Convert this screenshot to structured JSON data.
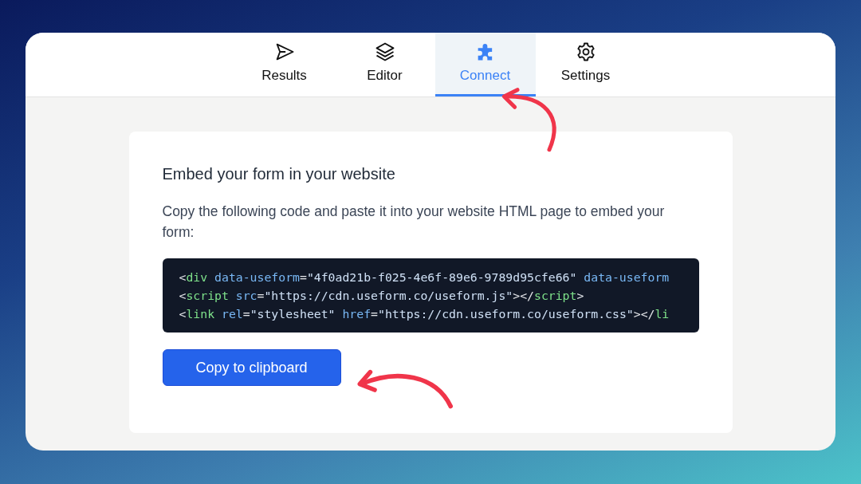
{
  "tabs": [
    {
      "label": "Results",
      "selected": false
    },
    {
      "label": "Editor",
      "selected": false
    },
    {
      "label": "Connect",
      "selected": true
    },
    {
      "label": "Settings",
      "selected": false
    }
  ],
  "embed": {
    "title": "Embed your form in your website",
    "description": "Copy the following code and paste it into your website HTML page to embed your form:",
    "code_lines": [
      [
        {
          "kind": "punct",
          "text": "<"
        },
        {
          "kind": "tag",
          "text": "div"
        },
        {
          "kind": "attr",
          "text": " data-useform"
        },
        {
          "kind": "punct",
          "text": "="
        },
        {
          "kind": "string",
          "text": "\"4f0ad21b-f025-4e6f-89e6-9789d95cfe66\""
        },
        {
          "kind": "attr",
          "text": " data-useform"
        }
      ],
      [
        {
          "kind": "punct",
          "text": "<"
        },
        {
          "kind": "tag",
          "text": "script"
        },
        {
          "kind": "attr",
          "text": " src"
        },
        {
          "kind": "punct",
          "text": "="
        },
        {
          "kind": "string",
          "text": "\"https://cdn.useform.co/useform.js\""
        },
        {
          "kind": "punct",
          "text": "></"
        },
        {
          "kind": "tag",
          "text": "script"
        },
        {
          "kind": "punct",
          "text": ">"
        }
      ],
      [
        {
          "kind": "punct",
          "text": "<"
        },
        {
          "kind": "tag",
          "text": "link"
        },
        {
          "kind": "attr",
          "text": " rel"
        },
        {
          "kind": "punct",
          "text": "="
        },
        {
          "kind": "string",
          "text": "\"stylesheet\""
        },
        {
          "kind": "attr",
          "text": " href"
        },
        {
          "kind": "punct",
          "text": "="
        },
        {
          "kind": "string",
          "text": "\"https://cdn.useform.co/useform.css\""
        },
        {
          "kind": "punct",
          "text": "></"
        },
        {
          "kind": "tag",
          "text": "li"
        }
      ]
    ],
    "button": "Copy to clipboard"
  }
}
